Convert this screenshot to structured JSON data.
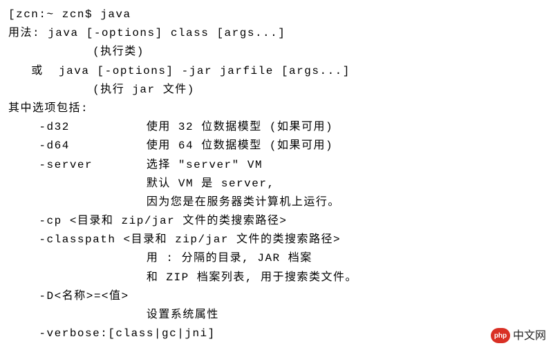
{
  "terminal": {
    "prompt": "[zcn:~ zcn$ java",
    "lines": [
      "用法: java [-options] class [args...]",
      "           (执行类)",
      "   或  java [-options] -jar jarfile [args...]",
      "           (执行 jar 文件)",
      "其中选项包括:",
      "    -d32          使用 32 位数据模型 (如果可用)",
      "    -d64          使用 64 位数据模型 (如果可用)",
      "    -server       选择 \"server\" VM",
      "                  默认 VM 是 server,",
      "                  因为您是在服务器类计算机上运行。",
      "",
      "",
      "    -cp <目录和 zip/jar 文件的类搜索路径>",
      "    -classpath <目录和 zip/jar 文件的类搜索路径>",
      "                  用 : 分隔的目录, JAR 档案",
      "                  和 ZIP 档案列表, 用于搜索类文件。",
      "    -D<名称>=<值>",
      "                  设置系统属性",
      "    -verbose:[class|gc|jni]"
    ]
  },
  "watermark": {
    "badge": "php",
    "text": "中文网"
  }
}
